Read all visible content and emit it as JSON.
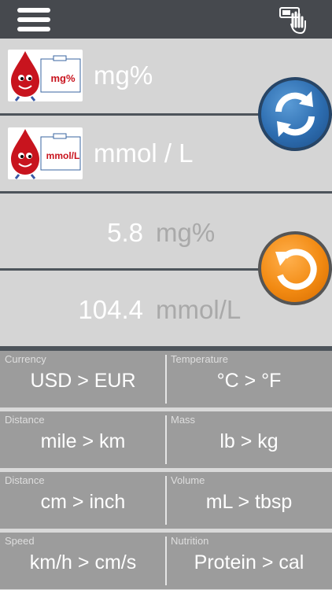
{
  "header": {
    "menu_icon": "hamburger-menu-icon",
    "touch_icon": "touch-calculator-icon"
  },
  "units": {
    "from": {
      "thumb_label": "mg%",
      "name": "mg%"
    },
    "to": {
      "thumb_label": "mmol/L",
      "name": "mmol / L"
    }
  },
  "values": {
    "from": {
      "number": "5.8",
      "unit": "mg%"
    },
    "to": {
      "number": "104.4",
      "unit": "mmol/L"
    }
  },
  "buttons": {
    "swap_icon": "swap-arrows-icon",
    "reset_icon": "reset-arrow-icon"
  },
  "shortcuts": [
    {
      "category": "Currency",
      "conversion": "USD > EUR"
    },
    {
      "category": "Temperature",
      "conversion": "°C > °F"
    },
    {
      "category": "Distance",
      "conversion": "mile > km"
    },
    {
      "category": "Mass",
      "conversion": "lb > kg"
    },
    {
      "category": "Distance",
      "conversion": "cm > inch"
    },
    {
      "category": "Volume",
      "conversion": "mL > tbsp"
    },
    {
      "category": "Speed",
      "conversion": "km/h > cm/s"
    },
    {
      "category": "Nutrition",
      "conversion": "Protein > cal"
    }
  ],
  "colors": {
    "header": "#46494e",
    "swap_button": "#2d6db0",
    "reset_button": "#f28a12",
    "drop_red": "#c8141e"
  }
}
